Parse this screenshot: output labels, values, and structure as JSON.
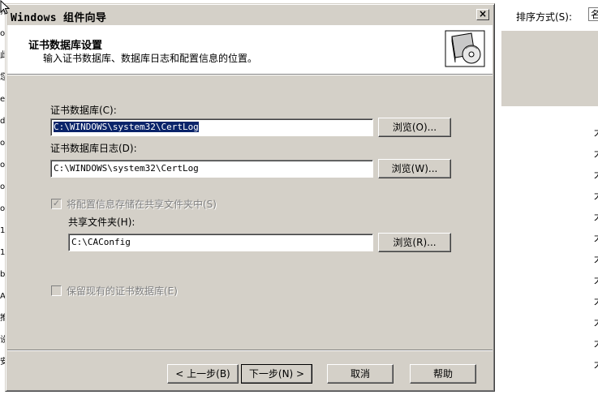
{
  "background": {
    "left_fragments": [
      "排",
      "o",
      "此",
      "您",
      "e",
      "d",
      "o",
      "o",
      "o",
      "o",
      "1",
      "1",
      "b",
      "A",
      "推",
      "设",
      "安"
    ],
    "sort_label": "排序方式(S):",
    "sort_value": "名",
    "right_column": [
      "大",
      "大",
      "大",
      "大",
      "大",
      "大",
      "大",
      "大",
      "大",
      "大",
      "大",
      "大"
    ]
  },
  "dialog": {
    "title": "Windows 组件向导",
    "close_label": "×",
    "header_title": "证书数据库设置",
    "header_subtitle": "输入证书数据库、数据库日志和配置信息的位置。",
    "db_label": "证书数据库(C):",
    "db_value": "C:\\WINDOWS\\system32\\CertLog",
    "db_browse": "浏览(O)...",
    "log_label": "证书数据库日志(D):",
    "log_value": "C:\\WINDOWS\\system32\\CertLog",
    "log_browse": "浏览(W)...",
    "share_checkbox_label": "将配置信息存储在共享文件夹中(S)",
    "share_checked": true,
    "share_folder_label": "共享文件夹(H):",
    "share_folder_value": "C:\\CAConfig",
    "share_browse": "浏览(R)...",
    "preserve_checkbox_label": "保留现有的证书数据库(E)",
    "preserve_checked": false,
    "back_button": "< 上一步(B)",
    "next_button": "下一步(N) >",
    "cancel_button": "取消",
    "help_button": "帮助"
  }
}
